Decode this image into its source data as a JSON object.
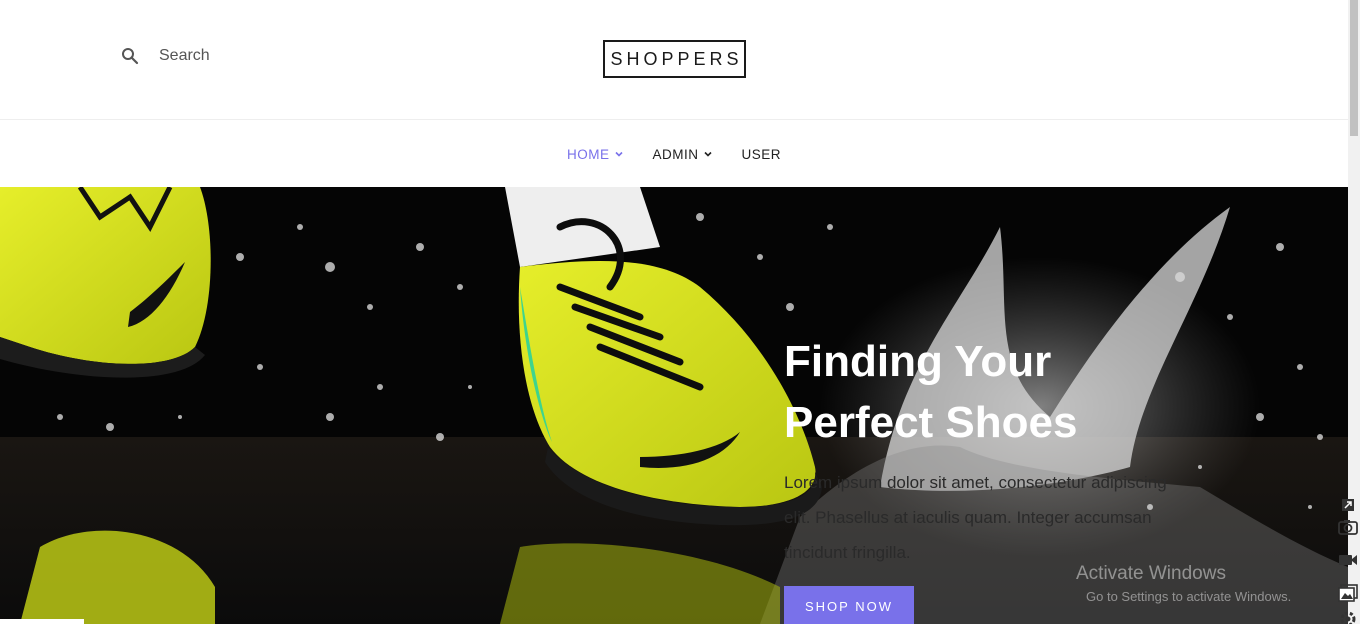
{
  "header": {
    "search": {
      "placeholder": "Search"
    },
    "logo": "SHOPPERS"
  },
  "nav": {
    "items": [
      {
        "label": "HOME",
        "dropdown": true,
        "active": true
      },
      {
        "label": "ADMIN",
        "dropdown": true,
        "active": false
      },
      {
        "label": "USER",
        "dropdown": false,
        "active": false
      }
    ]
  },
  "hero": {
    "title_line1": "Finding Your",
    "title_line2": "Perfect Shoes",
    "text_line1": "Lorem ipsum dolor sit amet, consectetur adipiscing",
    "text_line2": "elit. Phasellus at iaculis quam. Integer accumsan",
    "text_line3": "tincidunt fringilla.",
    "cta": "SHOP NOW"
  },
  "watermark": {
    "title": "Activate Windows",
    "subtitle": "Go to Settings to activate Windows."
  },
  "colors": {
    "accent": "#7971ea",
    "shoe": "#d4e21a",
    "hero_bg": "#050505"
  },
  "icons": [
    "search-icon",
    "chevron-down-icon",
    "camera-icon",
    "video-icon",
    "gallery-icon",
    "settings-icon",
    "expand-icon"
  ]
}
